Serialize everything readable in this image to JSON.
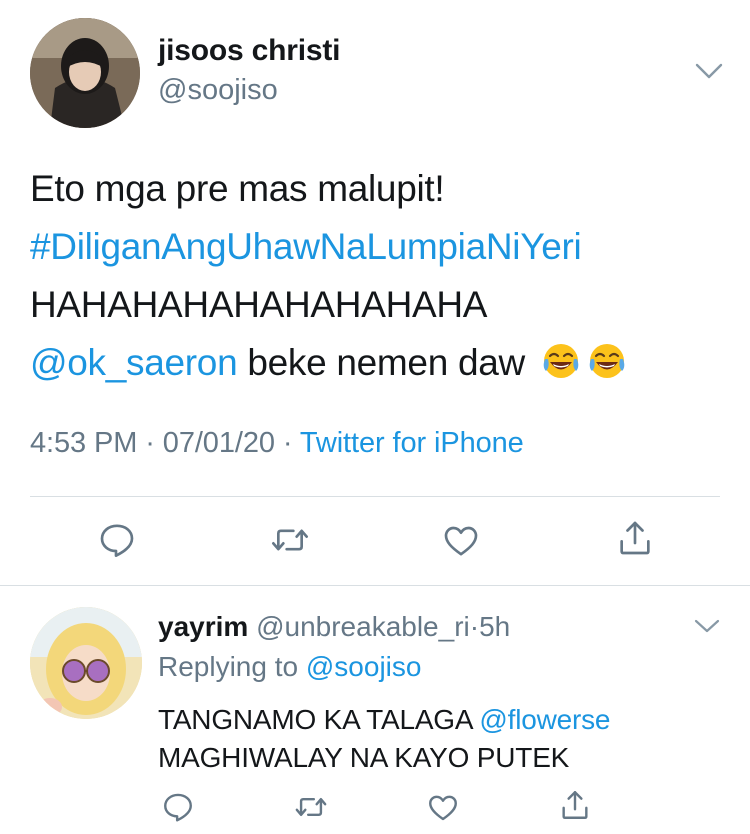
{
  "main_tweet": {
    "display_name": "jisoos christi",
    "handle": "@soojiso",
    "text_line1": "Eto mga pre mas malupit!",
    "hashtag": "#DiliganAngUhawNaLumpiaNiYeri",
    "text_line3": "HAHAHAHAHAHAHAHAHA",
    "mention": "@ok_saeron",
    "text_line4_rest": " beke nemen daw",
    "emoji_icon": "face-with-tears-of-joy-icon",
    "time": "4:53 PM",
    "dot1": " · ",
    "date": "07/01/20",
    "dot2": " · ",
    "source": "Twitter for iPhone",
    "actions": [
      "reply-icon",
      "retweet-icon",
      "like-icon",
      "share-icon"
    ]
  },
  "reply_tweet": {
    "display_name": "yayrim",
    "handle": "@unbreakable_ri",
    "dot": "·",
    "age": "5h",
    "replying_prefix": "Replying to ",
    "replying_to": "@soojiso",
    "text_line1": "TANGNAMO KA TALAGA ",
    "mention": "@flowerse",
    "text_line2": "MAGHIWALAY NA KAYO PUTEK",
    "actions": [
      "reply-icon",
      "retweet-icon",
      "like-icon",
      "share-icon"
    ]
  },
  "colors": {
    "link_blue": "#1b95e0",
    "secondary_grey": "#657786",
    "divider": "#d9dfe3",
    "text": "#14171a"
  }
}
